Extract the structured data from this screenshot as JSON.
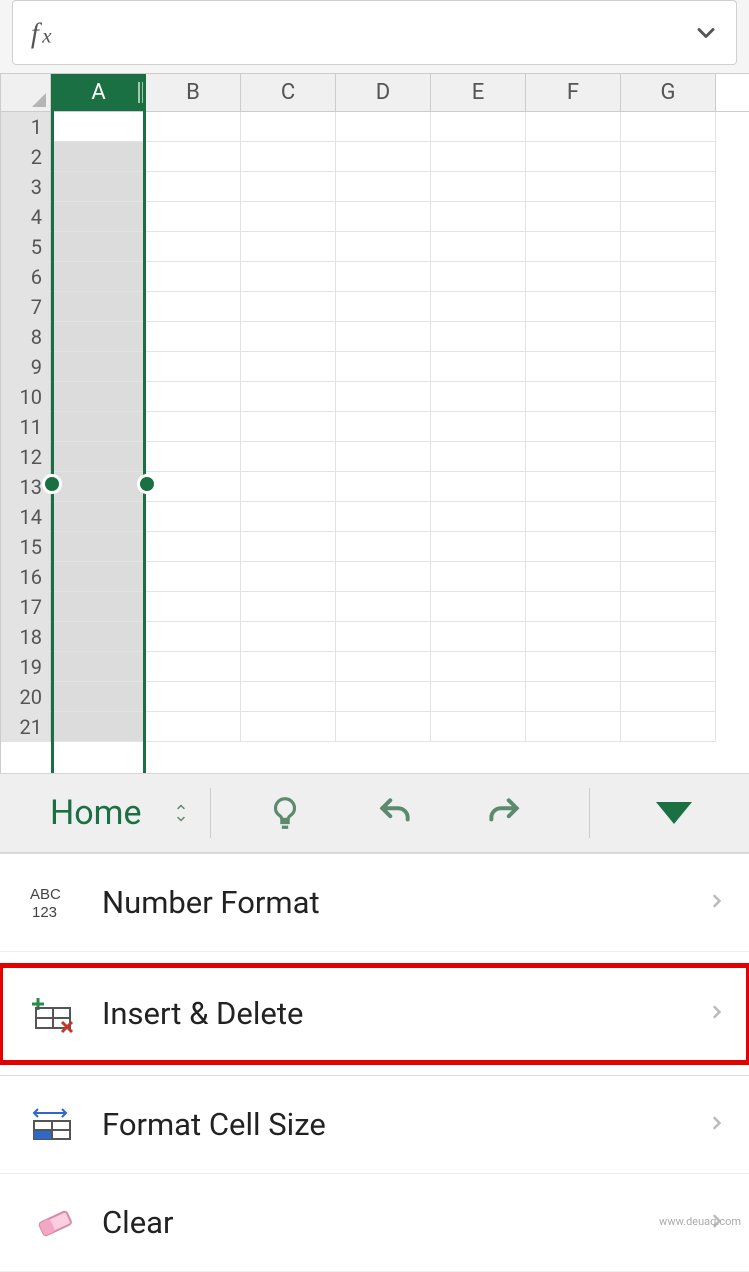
{
  "formula_bar": {
    "value": ""
  },
  "grid": {
    "columns": [
      "A",
      "B",
      "C",
      "D",
      "E",
      "F",
      "G"
    ],
    "selected_column_index": 0,
    "row_count": 21
  },
  "toolbar": {
    "tab_label": "Home"
  },
  "menu": {
    "items": [
      {
        "id": "number-format",
        "label": "Number Format",
        "highlight": false
      },
      {
        "id": "insert-delete",
        "label": "Insert & Delete",
        "highlight": true
      },
      {
        "id": "format-cell-size",
        "label": "Format Cell Size",
        "highlight": false
      },
      {
        "id": "clear",
        "label": "Clear",
        "highlight": false
      }
    ]
  },
  "watermark": "www.deuaq.com"
}
